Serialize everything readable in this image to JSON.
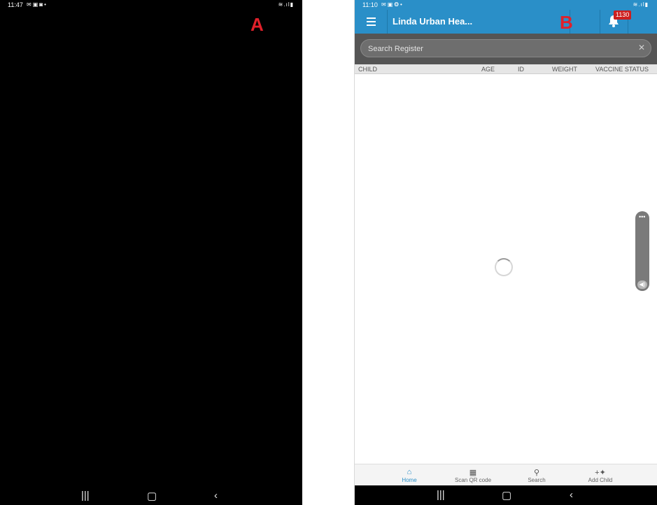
{
  "phone_a": {
    "time": "11:47",
    "label": "A"
  },
  "phone_b": {
    "time": "11:10",
    "label": "B",
    "app_title": "Linda Urban Hea...",
    "notification_count": "1130",
    "search": {
      "placeholder": "Search Register"
    },
    "table_headers": [
      "CHILD",
      "AGE",
      "ID",
      "WEIGHT",
      "VACCINE STATUS"
    ],
    "bottom_nav": [
      {
        "label": "Home",
        "icon": "home-icon"
      },
      {
        "label": "Scan QR code",
        "icon": "qr-code-icon"
      },
      {
        "label": "Search",
        "icon": "search-icon"
      },
      {
        "label": "Add Child",
        "icon": "add-child-icon"
      }
    ]
  },
  "colors": {
    "appbar": "#2a8fc8",
    "label": "#e0202a",
    "badge": "#cc1f1f"
  }
}
